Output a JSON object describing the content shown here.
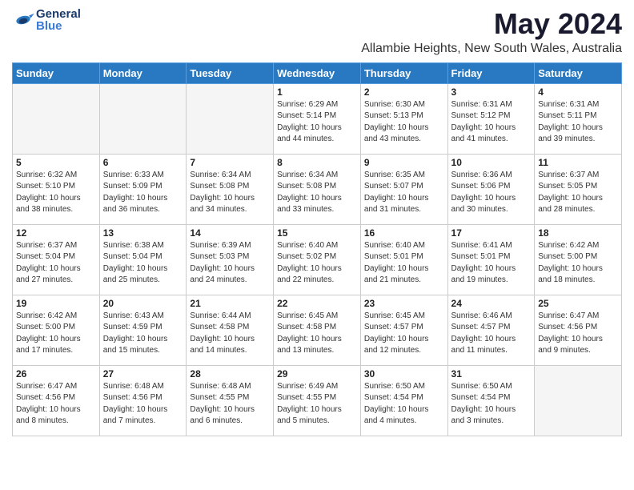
{
  "header": {
    "logo_general": "General",
    "logo_blue": "Blue",
    "title": "May 2024",
    "subtitle": "Allambie Heights, New South Wales, Australia"
  },
  "days_of_week": [
    "Sunday",
    "Monday",
    "Tuesday",
    "Wednesday",
    "Thursday",
    "Friday",
    "Saturday"
  ],
  "weeks": [
    [
      {
        "date": "",
        "info": ""
      },
      {
        "date": "",
        "info": ""
      },
      {
        "date": "",
        "info": ""
      },
      {
        "date": "1",
        "info": "Sunrise: 6:29 AM\nSunset: 5:14 PM\nDaylight: 10 hours\nand 44 minutes."
      },
      {
        "date": "2",
        "info": "Sunrise: 6:30 AM\nSunset: 5:13 PM\nDaylight: 10 hours\nand 43 minutes."
      },
      {
        "date": "3",
        "info": "Sunrise: 6:31 AM\nSunset: 5:12 PM\nDaylight: 10 hours\nand 41 minutes."
      },
      {
        "date": "4",
        "info": "Sunrise: 6:31 AM\nSunset: 5:11 PM\nDaylight: 10 hours\nand 39 minutes."
      }
    ],
    [
      {
        "date": "5",
        "info": "Sunrise: 6:32 AM\nSunset: 5:10 PM\nDaylight: 10 hours\nand 38 minutes."
      },
      {
        "date": "6",
        "info": "Sunrise: 6:33 AM\nSunset: 5:09 PM\nDaylight: 10 hours\nand 36 minutes."
      },
      {
        "date": "7",
        "info": "Sunrise: 6:34 AM\nSunset: 5:08 PM\nDaylight: 10 hours\nand 34 minutes."
      },
      {
        "date": "8",
        "info": "Sunrise: 6:34 AM\nSunset: 5:08 PM\nDaylight: 10 hours\nand 33 minutes."
      },
      {
        "date": "9",
        "info": "Sunrise: 6:35 AM\nSunset: 5:07 PM\nDaylight: 10 hours\nand 31 minutes."
      },
      {
        "date": "10",
        "info": "Sunrise: 6:36 AM\nSunset: 5:06 PM\nDaylight: 10 hours\nand 30 minutes."
      },
      {
        "date": "11",
        "info": "Sunrise: 6:37 AM\nSunset: 5:05 PM\nDaylight: 10 hours\nand 28 minutes."
      }
    ],
    [
      {
        "date": "12",
        "info": "Sunrise: 6:37 AM\nSunset: 5:04 PM\nDaylight: 10 hours\nand 27 minutes."
      },
      {
        "date": "13",
        "info": "Sunrise: 6:38 AM\nSunset: 5:04 PM\nDaylight: 10 hours\nand 25 minutes."
      },
      {
        "date": "14",
        "info": "Sunrise: 6:39 AM\nSunset: 5:03 PM\nDaylight: 10 hours\nand 24 minutes."
      },
      {
        "date": "15",
        "info": "Sunrise: 6:40 AM\nSunset: 5:02 PM\nDaylight: 10 hours\nand 22 minutes."
      },
      {
        "date": "16",
        "info": "Sunrise: 6:40 AM\nSunset: 5:01 PM\nDaylight: 10 hours\nand 21 minutes."
      },
      {
        "date": "17",
        "info": "Sunrise: 6:41 AM\nSunset: 5:01 PM\nDaylight: 10 hours\nand 19 minutes."
      },
      {
        "date": "18",
        "info": "Sunrise: 6:42 AM\nSunset: 5:00 PM\nDaylight: 10 hours\nand 18 minutes."
      }
    ],
    [
      {
        "date": "19",
        "info": "Sunrise: 6:42 AM\nSunset: 5:00 PM\nDaylight: 10 hours\nand 17 minutes."
      },
      {
        "date": "20",
        "info": "Sunrise: 6:43 AM\nSunset: 4:59 PM\nDaylight: 10 hours\nand 15 minutes."
      },
      {
        "date": "21",
        "info": "Sunrise: 6:44 AM\nSunset: 4:58 PM\nDaylight: 10 hours\nand 14 minutes."
      },
      {
        "date": "22",
        "info": "Sunrise: 6:45 AM\nSunset: 4:58 PM\nDaylight: 10 hours\nand 13 minutes."
      },
      {
        "date": "23",
        "info": "Sunrise: 6:45 AM\nSunset: 4:57 PM\nDaylight: 10 hours\nand 12 minutes."
      },
      {
        "date": "24",
        "info": "Sunrise: 6:46 AM\nSunset: 4:57 PM\nDaylight: 10 hours\nand 11 minutes."
      },
      {
        "date": "25",
        "info": "Sunrise: 6:47 AM\nSunset: 4:56 PM\nDaylight: 10 hours\nand 9 minutes."
      }
    ],
    [
      {
        "date": "26",
        "info": "Sunrise: 6:47 AM\nSunset: 4:56 PM\nDaylight: 10 hours\nand 8 minutes."
      },
      {
        "date": "27",
        "info": "Sunrise: 6:48 AM\nSunset: 4:56 PM\nDaylight: 10 hours\nand 7 minutes."
      },
      {
        "date": "28",
        "info": "Sunrise: 6:48 AM\nSunset: 4:55 PM\nDaylight: 10 hours\nand 6 minutes."
      },
      {
        "date": "29",
        "info": "Sunrise: 6:49 AM\nSunset: 4:55 PM\nDaylight: 10 hours\nand 5 minutes."
      },
      {
        "date": "30",
        "info": "Sunrise: 6:50 AM\nSunset: 4:54 PM\nDaylight: 10 hours\nand 4 minutes."
      },
      {
        "date": "31",
        "info": "Sunrise: 6:50 AM\nSunset: 4:54 PM\nDaylight: 10 hours\nand 3 minutes."
      },
      {
        "date": "",
        "info": ""
      }
    ]
  ]
}
